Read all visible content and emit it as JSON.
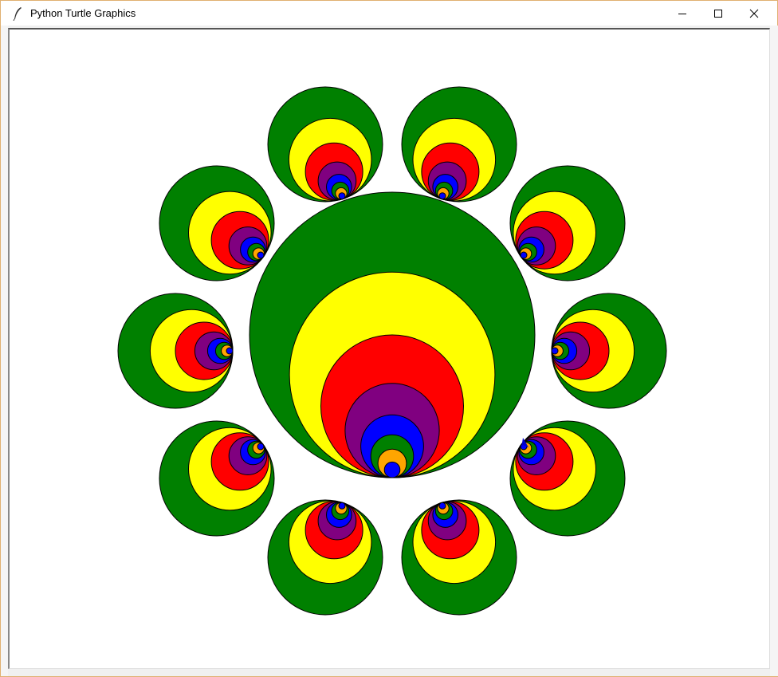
{
  "window": {
    "title": "Python Turtle Graphics",
    "controls": {
      "minimize_icon": "minimize-icon",
      "maximize_icon": "maximize-icon",
      "close_icon": "close-icon"
    }
  },
  "colors": {
    "ring_order": [
      "#008000",
      "#ffff00",
      "#ff0000",
      "#800080",
      "#0000ff",
      "#008000",
      "#ffa500",
      "#0000ff"
    ],
    "stroke": "#000000",
    "canvas_background": "#ffffff",
    "turtle": "#0000cc"
  }
}
